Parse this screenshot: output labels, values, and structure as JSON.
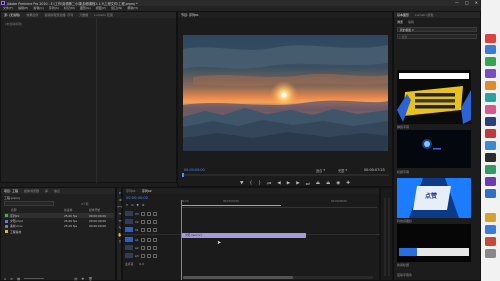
{
  "window": {
    "title": "Adobe Premiere Pro 2020 - E:\\工作\\剪辑第二小课\\剪辑课程2.1.3\\工程文件\\工程.prproj *",
    "controls": [
      "—",
      "□",
      "✕"
    ]
  },
  "menubar": [
    "文件(F)",
    "编辑(E)",
    "剪辑(C)",
    "序列(S)",
    "标记(M)",
    "图形(G)",
    "视图(V)",
    "窗口(W)",
    "帮助(H)"
  ],
  "source_panel": {
    "tabs": [
      "源: (无剪辑)",
      "效果控件",
      "音频剪辑混合器: 序列",
      "元数据",
      "Lumetri 范围"
    ],
    "empty_label": "(未选择剪辑)"
  },
  "program_monitor": {
    "tab": "节目: 序列01",
    "timecode_left": "00:00:00:00",
    "fit_label": "适合",
    "quality_label": "完整",
    "timecode_right": "00:00:07:23"
  },
  "project_panel": {
    "tabs": [
      "项目: 工程",
      "媒体浏览器",
      "库",
      "信息"
    ],
    "filename": "工程.prproj",
    "item_count": "4个项",
    "columns": [
      "名称",
      "帧速率",
      "媒体开始"
    ],
    "items": [
      {
        "name": "序列01",
        "fps": "25.00 fps",
        "start": "00:00:00:00",
        "color": "#3fb04f"
      },
      {
        "name": "夕阳.mp4",
        "fps": "25.00 fps",
        "start": "00:00:00:00",
        "color": "#6b76d8"
      },
      {
        "name": "素材.mov",
        "fps": "25.00 fps",
        "start": "00:00:00:00",
        "color": "#6b76d8"
      },
      {
        "name": "工程素材",
        "fps": "",
        "start": "",
        "color": "#e0b43b"
      }
    ]
  },
  "timeline": {
    "tabs": [
      "序列01",
      "序列02"
    ],
    "timecode": "00:00:00:00",
    "ruler": [
      "00:00",
      "00:00:04:00",
      "00:00:08:00"
    ],
    "video_tracks": [
      "V3",
      "V2",
      "V1"
    ],
    "audio_tracks": [
      "A1",
      "A2",
      "A3"
    ],
    "clip_label": "夕阳.mp4 [V]",
    "master_label": "主声道",
    "master_value": "0.0"
  },
  "templates_panel": {
    "tabs": [
      "基本图形",
      "Lumetri 颜色"
    ],
    "subtabs": [
      "浏览",
      "编辑"
    ],
    "filter_label": "我的模板",
    "search_placeholder": "搜索",
    "items": [
      {
        "caption": "弹窗字幕"
      },
      {
        "caption": "标题字幕"
      },
      {
        "caption": "科技感图标"
      },
      {
        "caption": "新闻标题"
      },
      {
        "caption": "竖版字幕条"
      }
    ],
    "cta_label": "点赞"
  },
  "colors": {
    "accent": "#2d8ceb",
    "playhead": "#4d8fff",
    "clip": "#a79ad8",
    "sidebar": "#f2f2f2"
  }
}
